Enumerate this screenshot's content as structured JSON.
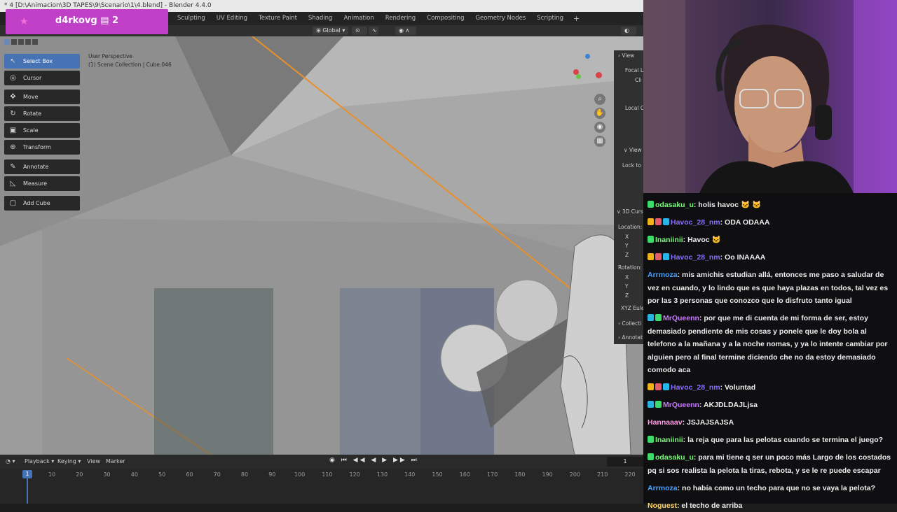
{
  "blender": {
    "title": "* 4 [D:\\Animacion\\3D TAPES\\9\\Scenario\\1\\4.blend] - Blender 4.4.0",
    "workspace_tabs": [
      "Sculpting",
      "UV Editing",
      "Texture Paint",
      "Shading",
      "Animation",
      "Rendering",
      "Compositing",
      "Geometry Nodes",
      "Scripting"
    ],
    "add_tab": "+",
    "header": {
      "orientation": "Global"
    },
    "viewport": {
      "perspective": "User Perspective",
      "collection_info": "(1) Scene Collection | Cube.046"
    },
    "tools": [
      {
        "label": "Select Box",
        "icon": "select-box-icon",
        "active": true
      },
      {
        "label": "Cursor",
        "icon": "cursor-icon"
      },
      {
        "label": "Move",
        "icon": "move-icon"
      },
      {
        "label": "Rotate",
        "icon": "rotate-icon"
      },
      {
        "label": "Scale",
        "icon": "scale-icon"
      },
      {
        "label": "Transform",
        "icon": "transform-icon"
      },
      {
        "label": "Annotate",
        "icon": "annotate-icon"
      },
      {
        "label": "Measure",
        "icon": "measure-icon"
      },
      {
        "label": "Add Cube",
        "icon": "add-cube-icon"
      }
    ],
    "npanel": {
      "view_header": "View",
      "focal": "Focal L",
      "clip": "Cli",
      "local_camera": "Local C",
      "view_lock": "View",
      "lock_to": "Lock to",
      "cursor_header": "3D Curs",
      "location": "Location:",
      "x": "X",
      "y": "Y",
      "z": "Z",
      "rotation": "Rotation:",
      "rx": "X",
      "ry": "Y",
      "rz": "Z",
      "euler": "XYZ Eule",
      "collections": "Collecti",
      "annotations": "Annotat"
    },
    "timeline": {
      "menus": [
        "Playback",
        "Keying",
        "View",
        "Marker"
      ],
      "current_frame": "1",
      "frame_field": "1",
      "ticks": [
        "10",
        "20",
        "30",
        "40",
        "50",
        "60",
        "70",
        "80",
        "90",
        "100",
        "110",
        "120",
        "130",
        "140",
        "150",
        "160",
        "170",
        "180",
        "190",
        "200",
        "210",
        "220"
      ]
    }
  },
  "overlay": {
    "streamer_name": "d4rkovg",
    "banner_suffix": "2"
  },
  "chat": [
    {
      "user": "odasaku_u",
      "color": "#7bf67b",
      "badges": [
        "#3ddb6a"
      ],
      "text": "holis havoc 🐱 🐱"
    },
    {
      "user": "Havoc_28_nm",
      "color": "#8a6cff",
      "badges": [
        "#f2b21a",
        "#e85a6a",
        "#28b6e8"
      ],
      "text": "ODA ODAAA"
    },
    {
      "user": "Inaniinii",
      "color": "#7bf67b",
      "badges": [
        "#3ddb6a"
      ],
      "text": "Havoc 🐱"
    },
    {
      "user": "Havoc_28_nm",
      "color": "#8a6cff",
      "badges": [
        "#f2b21a",
        "#e85a6a",
        "#28b6e8"
      ],
      "text": "Oo INAAAA"
    },
    {
      "user": "Arrmoza",
      "color": "#4aa3ff",
      "badges": [],
      "text": "mis amichis estudian allá, entonces me paso a saludar de vez en cuando, y lo lindo que es que haya plazas en todos, tal vez es por las 3 personas que conozco que lo disfruto tanto igual"
    },
    {
      "user": "MrQueenn",
      "color": "#c77bff",
      "badges": [
        "#2ab3e0",
        "#3ddb6a"
      ],
      "text": "por que me di cuenta de mi forma de ser, estoy demasiado pendiente de mis cosas y ponele que le doy bola al telefono a la mañana y a la noche nomas, y ya lo intente cambiar por alguien pero al final termine diciendo che no da estoy demasiado comodo aca"
    },
    {
      "user": "Havoc_28_nm",
      "color": "#8a6cff",
      "badges": [
        "#f2b21a",
        "#e85a6a",
        "#28b6e8"
      ],
      "text": "Voluntad"
    },
    {
      "user": "MrQueenn",
      "color": "#c77bff",
      "badges": [
        "#2ab3e0",
        "#3ddb6a"
      ],
      "text": "AKJDLDAJLjsa"
    },
    {
      "user": "Hannaaav",
      "color": "#ff9de6",
      "badges": [],
      "text": "JSJAJSAJSA"
    },
    {
      "user": "Inaniinii",
      "color": "#7bf67b",
      "badges": [
        "#3ddb6a"
      ],
      "text": "la reja que para las pelotas cuando se termina el juego?"
    },
    {
      "user": "odasaku_u",
      "color": "#7bf67b",
      "badges": [
        "#3ddb6a"
      ],
      "text": "para mi tiene q ser un poco más Largo de los costados pq si sos realista la pelota la tiras, rebota, y se le re puede escapar"
    },
    {
      "user": "Arrmoza",
      "color": "#4aa3ff",
      "badges": [],
      "text": "no había como un techo para que no se vaya la pelota?"
    },
    {
      "user": "Noguest",
      "color": "#ffd35a",
      "badges": [],
      "text": "el techo de arriba"
    }
  ]
}
